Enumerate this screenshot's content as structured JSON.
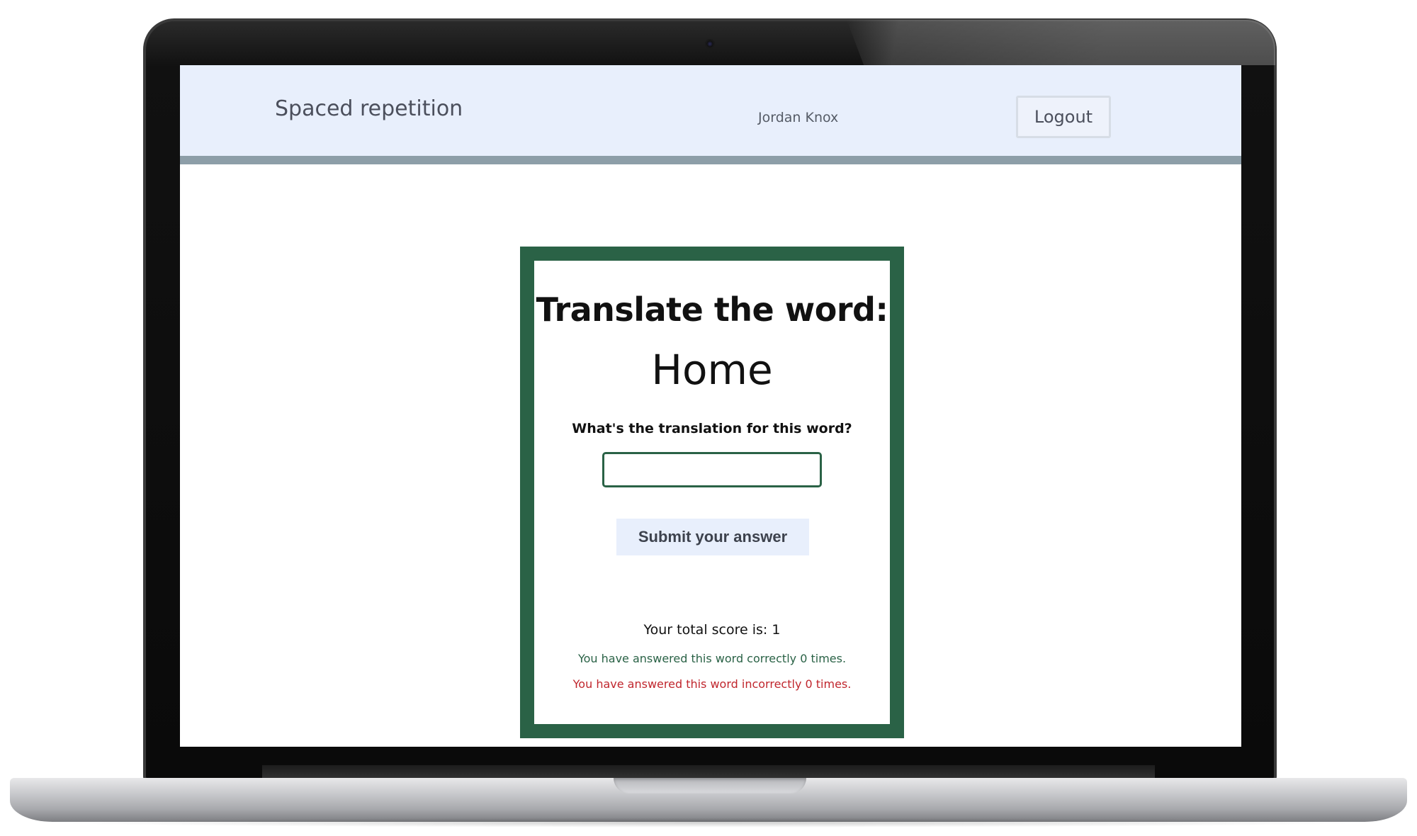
{
  "app": {
    "title": "Spaced repetition",
    "user_name": "Jordan Knox",
    "logout_label": "Logout"
  },
  "learning": {
    "heading": "Translate the word:",
    "word": "Home",
    "question": "What's the translation for this word?",
    "answer_value": "",
    "submit_label": "Submit your answer",
    "score_text": "Your total score is: 1",
    "correct_text": "You have answered this word correctly 0 times.",
    "incorrect_text": "You have answered this word incorrectly 0 times."
  },
  "colors": {
    "header_bg": "#e8effc",
    "header_rule": "#8d9ea8",
    "card_border": "#2a6246",
    "correct": "#2a6246",
    "incorrect": "#c0262d"
  }
}
